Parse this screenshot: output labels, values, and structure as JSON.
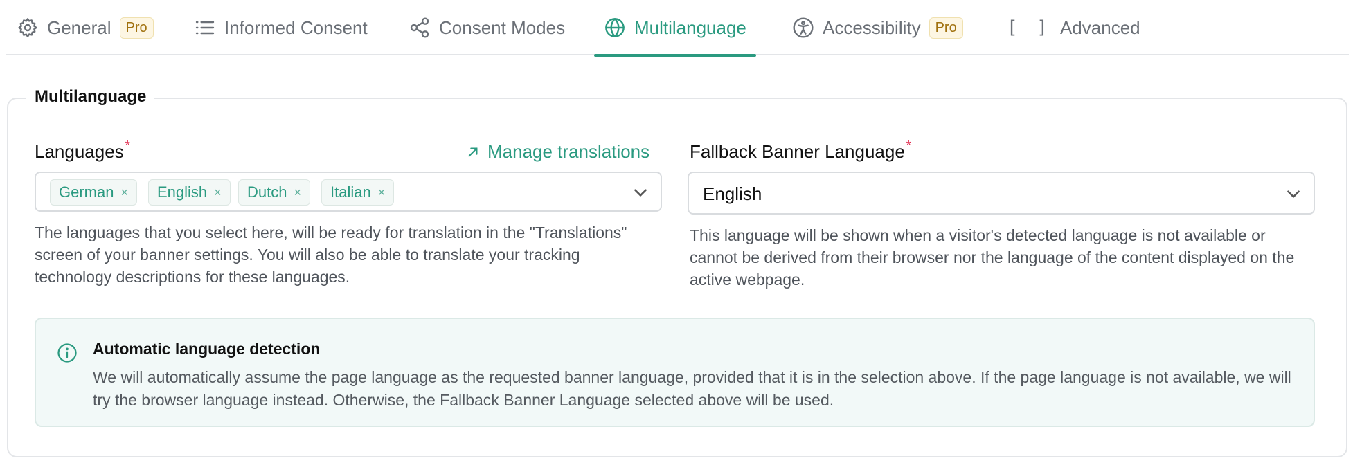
{
  "tabs": [
    {
      "label": "General",
      "icon": "gear-icon",
      "badge": "Pro"
    },
    {
      "label": "Informed Consent",
      "icon": "list-icon"
    },
    {
      "label": "Consent Modes",
      "icon": "share-icon"
    },
    {
      "label": "Multilanguage",
      "icon": "globe-icon",
      "active": true
    },
    {
      "label": "Accessibility",
      "icon": "accessibility-icon",
      "badge": "Pro"
    },
    {
      "label": "Advanced",
      "icon": "brackets-icon",
      "icon_text": "[ ]"
    }
  ],
  "section": {
    "title": "Multilanguage"
  },
  "languages": {
    "label": "Languages",
    "required_mark": "*",
    "manage_link": "Manage translations",
    "selected": [
      "German",
      "English",
      "Dutch",
      "Italian"
    ],
    "remove_glyph": "×",
    "help": "The languages that you select here, will be ready for translation in the \"Translations\" screen of your banner settings. You will also be able to translate your tracking technology descriptions for these languages."
  },
  "fallback": {
    "label": "Fallback Banner Language",
    "required_mark": "*",
    "value": "English",
    "help": "This language will be shown when a visitor's detected language is not available or cannot be derived from their browser nor the language of the content displayed on the active webpage."
  },
  "info": {
    "title": "Automatic language detection",
    "body": "We will automatically assume the page language as the requested banner language, provided that it is in the selection above. If the page language is not available, we will try the browser language instead. Otherwise, the Fallback Banner Language selected above will be used."
  },
  "colors": {
    "accent": "#2a9a80",
    "pro_badge": "#a0710f",
    "required": "#e0264a"
  }
}
